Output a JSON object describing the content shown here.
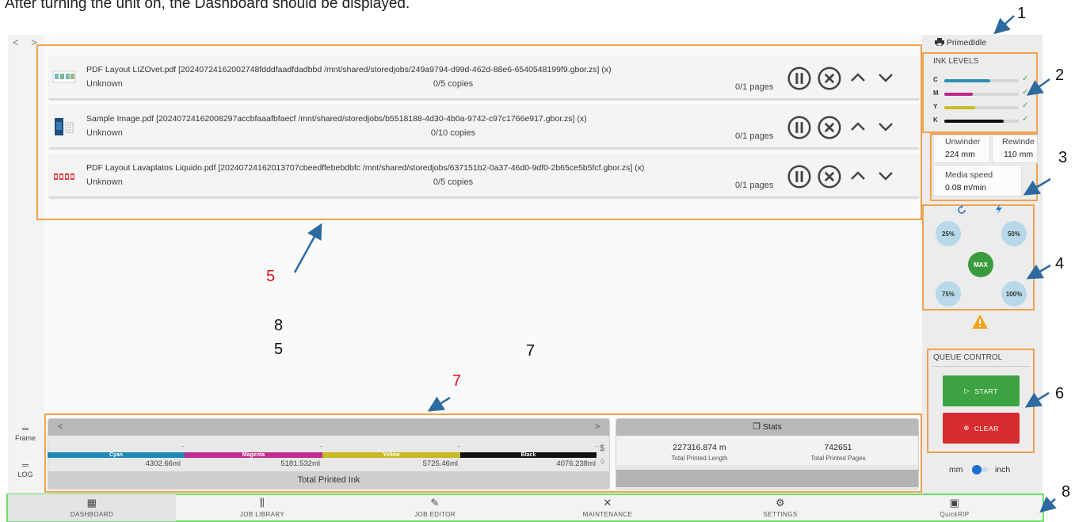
{
  "caption": "After turning the unit on, the Dashboard should be displayed.",
  "nav_arrows": "< >",
  "jobs": [
    {
      "title": "PDF Layout LIZOvet.pdf [20240724162002748fdddfaadfdadbbd /mnt/shared/storedjobs/249a9794-d99d-462d-88e6-6540548199f9.gbor.zs] (x)",
      "owner": "Unknown",
      "copies": "0/5 copies",
      "pages": "0/1 pages"
    },
    {
      "title": "Sample Image.pdf [20240724162008297accbfaaafbfaecf /mnt/shared/storedjobs/b5518188-4d30-4b0a-9742-c97c1766e917.gbor.zs] (x)",
      "owner": "Unknown",
      "copies": "0/10 copies",
      "pages": "0/1 pages"
    },
    {
      "title": "PDF Layout Lavaplatos Liquido.pdf [20240724162013707cbeedffebebdbfc /mnt/shared/storedjobs/637151b2-0a37-46d0-9df0-2b65ce5b5fcf.gbor.zs] (x)",
      "owner": "Unknown",
      "copies": "0/5 copies",
      "pages": "0/1 pages"
    }
  ],
  "printer": {
    "status": "PrimedIdle"
  },
  "ink_levels": {
    "title": "INK LEVELS",
    "items": [
      {
        "label": "C",
        "level": 0.62,
        "color": "#2a8fb0"
      },
      {
        "label": "M",
        "level": 0.38,
        "color": "#c0288a"
      },
      {
        "label": "Y",
        "level": 0.42,
        "color": "#c8c020"
      },
      {
        "label": "K",
        "level": 0.8,
        "color": "#111111"
      }
    ]
  },
  "media": {
    "unwinder_label": "Unwinder",
    "unwinder_value": "224 mm",
    "rewinder_label": "Rewinde",
    "rewinder_value": "110 mm",
    "speed_label": "Media speed",
    "speed_value": "0.08 m/min"
  },
  "speed_presets": {
    "p25": "25%",
    "p50": "50%",
    "max": "MAX",
    "p75": "75%",
    "p100": "100%"
  },
  "queue": {
    "title": "QUEUE CONTROL",
    "start": "START",
    "clear": "CLEAR"
  },
  "units": {
    "mm": "mm",
    "inch": "inch"
  },
  "side": {
    "frame": "Frame",
    "log": "LOG"
  },
  "ink_panel": {
    "title": "Total Printed Ink",
    "colors": [
      {
        "name": "Cyan",
        "ml": "4302.66ml",
        "color": "#1b8ab5"
      },
      {
        "name": "Magenta",
        "ml": "5181.532ml",
        "color": "#c32b8e"
      },
      {
        "name": "Yellow",
        "ml": "5725.46ml",
        "color": "#c9b81f"
      },
      {
        "name": "Black",
        "ml": "4076.238ml",
        "color": "#111111"
      }
    ],
    "dash": "-",
    "dollar": "$"
  },
  "stats": {
    "title": "Stats",
    "length_value": "227316.874 m",
    "length_label": "Total Printed Length",
    "pages_value": "742651",
    "pages_label": "Total Printed Pages"
  },
  "annotations": {
    "a1": "1",
    "a2": "2",
    "a3": "3",
    "a4": "4",
    "a5": "5",
    "a5b": "5",
    "a6": "6",
    "a7": "7",
    "a7b": "7",
    "a8": "8",
    "a8b": "8"
  },
  "bottom_nav": [
    {
      "label": "DASHBOARD",
      "icon": "dashboard-icon"
    },
    {
      "label": "JOB LIBRARY",
      "icon": "library-icon"
    },
    {
      "label": "JOB EDITOR",
      "icon": "pencil-icon"
    },
    {
      "label": "MAINTENANCE",
      "icon": "tools-icon"
    },
    {
      "label": "SETTINGS",
      "icon": "gear-icon"
    },
    {
      "label": "QuickRIP",
      "icon": "quickrip-icon"
    }
  ]
}
